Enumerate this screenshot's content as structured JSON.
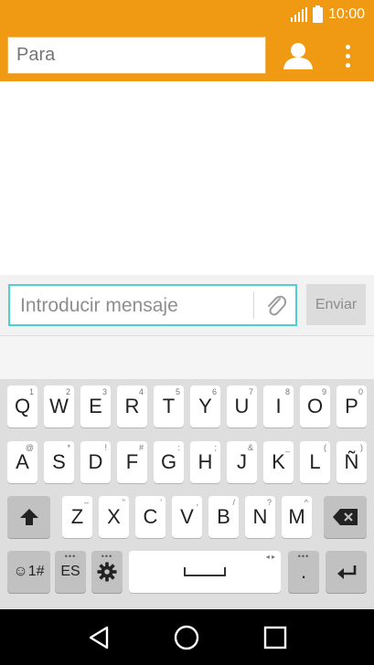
{
  "status_bar": {
    "time": "10:00",
    "signal_icon": "signal-icon",
    "battery_icon": "battery-icon"
  },
  "action_bar": {
    "to_placeholder": "Para",
    "contact_icon": "person-icon",
    "menu_icon": "overflow-menu-icon",
    "accent_color": "#f09a13"
  },
  "composer": {
    "message_placeholder": "Introducir mensaje",
    "attach_icon": "paperclip-icon",
    "send_label": "Enviar",
    "focus_color": "#4fd0cf"
  },
  "keyboard": {
    "row1": [
      {
        "label": "Q",
        "hint": "1"
      },
      {
        "label": "W",
        "hint": "2"
      },
      {
        "label": "E",
        "hint": "3"
      },
      {
        "label": "R",
        "hint": "4"
      },
      {
        "label": "T",
        "hint": "5"
      },
      {
        "label": "Y",
        "hint": "6"
      },
      {
        "label": "U",
        "hint": "7"
      },
      {
        "label": "I",
        "hint": "8"
      },
      {
        "label": "O",
        "hint": "9"
      },
      {
        "label": "P",
        "hint": "0"
      }
    ],
    "row2": [
      {
        "label": "A",
        "hint": "@"
      },
      {
        "label": "S",
        "hint": "*"
      },
      {
        "label": "D",
        "hint": "!"
      },
      {
        "label": "F",
        "hint": "#"
      },
      {
        "label": "G",
        "hint": ":"
      },
      {
        "label": "H",
        "hint": ";"
      },
      {
        "label": "J",
        "hint": "&"
      },
      {
        "label": "K",
        "hint": "_"
      },
      {
        "label": "L",
        "hint": "("
      },
      {
        "label": "Ñ",
        "hint": ")"
      }
    ],
    "row3": [
      {
        "label": "Z",
        "hint": "–"
      },
      {
        "label": "X",
        "hint": "\""
      },
      {
        "label": "C",
        "hint": "'"
      },
      {
        "label": "V",
        "hint": ","
      },
      {
        "label": "B",
        "hint": "/"
      },
      {
        "label": "N",
        "hint": "?"
      },
      {
        "label": "M",
        "hint": "^"
      }
    ],
    "shift_icon": "shift-icon",
    "backspace_icon": "backspace-icon",
    "symbols_label": "☺1#",
    "language_label": "ES",
    "settings_icon": "gear-icon",
    "period_label": ".",
    "enter_icon": "enter-icon"
  },
  "nav_bar": {
    "back_icon": "back-triangle-icon",
    "home_icon": "home-circle-icon",
    "recents_icon": "recents-square-icon"
  }
}
